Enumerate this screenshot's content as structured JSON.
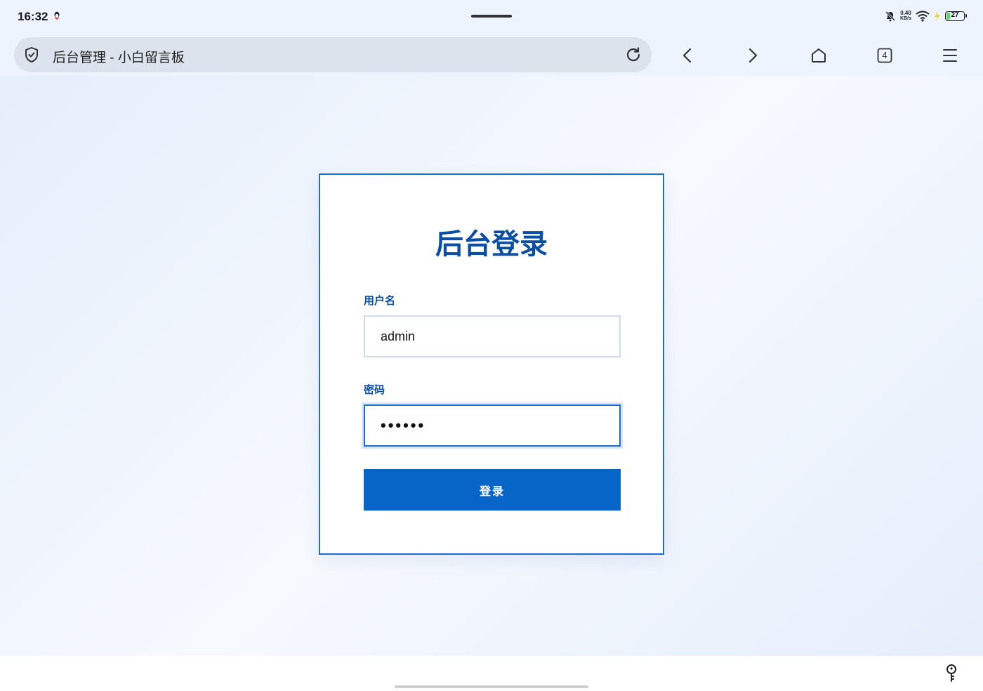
{
  "status_bar": {
    "time": "16:32",
    "net_speed_value": "0.40",
    "net_speed_unit": "KB/s",
    "battery_level": "27",
    "battery_color": "#5fd36b"
  },
  "browser": {
    "page_title": "后台管理 - 小白留言板",
    "tab_count": "4"
  },
  "login": {
    "title": "后台登录",
    "username_label": "用户名",
    "username_value": "admin",
    "password_label": "密码",
    "password_value": "••••••",
    "submit_label": "登录"
  },
  "colors": {
    "accent": "#0865c8",
    "title": "#0b4fa3",
    "border": "#1a6fd0"
  },
  "icons": [
    "qq-icon",
    "mute-icon",
    "wifi-icon",
    "charging-icon",
    "battery-icon",
    "shield-icon",
    "reload-icon",
    "back-icon",
    "forward-icon",
    "home-icon",
    "tabs-icon",
    "menu-icon",
    "key-icon"
  ]
}
